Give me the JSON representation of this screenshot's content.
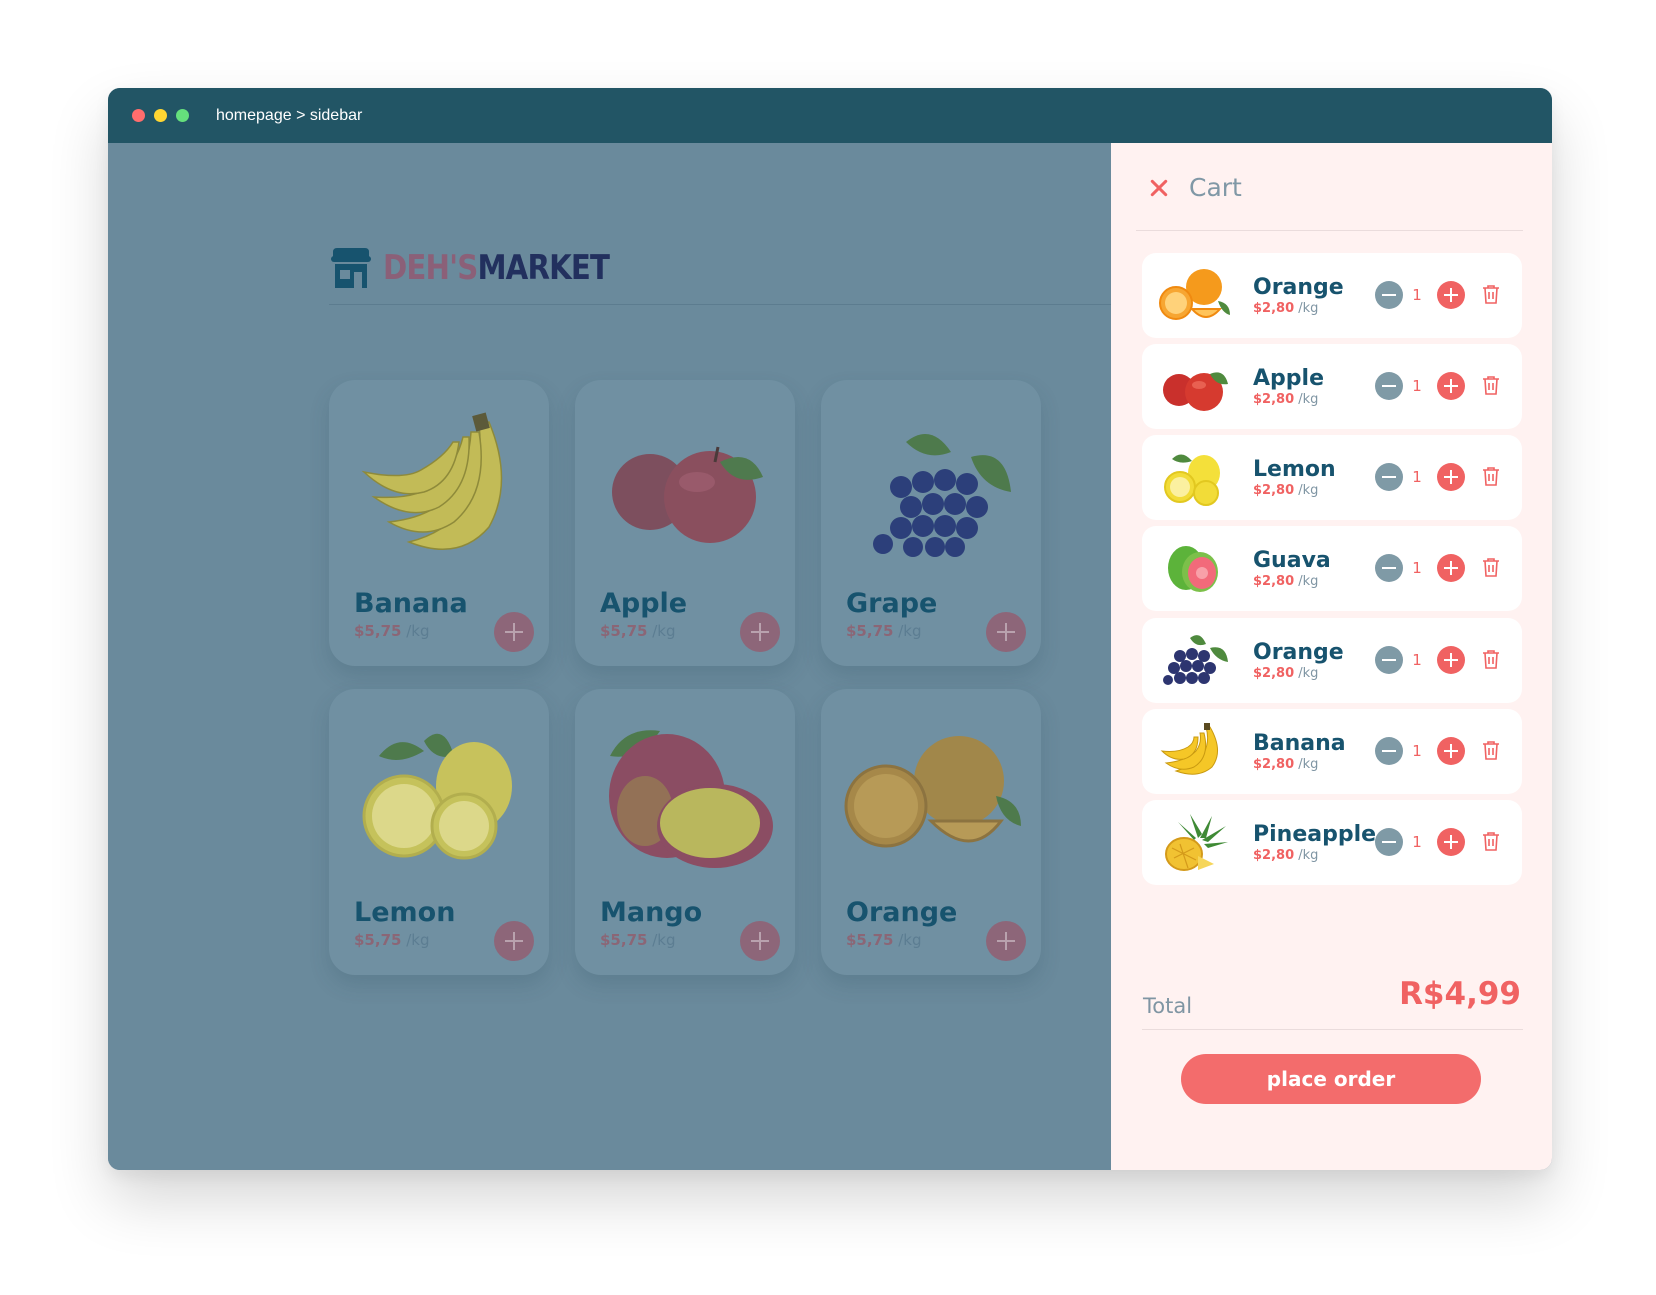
{
  "window": {
    "breadcrumb": "homepage > sidebar"
  },
  "brand": {
    "name_part1": "DEH'S",
    "name_part2": "MARKET",
    "colors": {
      "part1": "#8b6078",
      "part2": "#22305e"
    }
  },
  "products": [
    {
      "name": "Banana",
      "price": "$5,75",
      "unit": "/kg",
      "icon": "banana"
    },
    {
      "name": "Apple",
      "price": "$5,75",
      "unit": "/kg",
      "icon": "apple"
    },
    {
      "name": "Grape",
      "price": "$5,75",
      "unit": "/kg",
      "icon": "grape"
    },
    {
      "name": "Lemon",
      "price": "$5,75",
      "unit": "/kg",
      "icon": "lemon"
    },
    {
      "name": "Mango",
      "price": "$5,75",
      "unit": "/kg",
      "icon": "mango"
    },
    {
      "name": "Orange",
      "price": "$5,75",
      "unit": "/kg",
      "icon": "orange"
    }
  ],
  "cart": {
    "title": "Cart",
    "items": [
      {
        "name": "Orange",
        "price": "$2,80",
        "unit": "/kg",
        "qty": "1",
        "icon": "orange"
      },
      {
        "name": "Apple",
        "price": "$2,80",
        "unit": "/kg",
        "qty": "1",
        "icon": "apple"
      },
      {
        "name": "Lemon",
        "price": "$2,80",
        "unit": "/kg",
        "qty": "1",
        "icon": "lemon"
      },
      {
        "name": "Guava",
        "price": "$2,80",
        "unit": "/kg",
        "qty": "1",
        "icon": "guava"
      },
      {
        "name": "Orange",
        "price": "$2,80",
        "unit": "/kg",
        "qty": "1",
        "icon": "grape"
      },
      {
        "name": "Banana",
        "price": "$2,80",
        "unit": "/kg",
        "qty": "1",
        "icon": "banana"
      },
      {
        "name": "Pineapple",
        "price": "$2,80",
        "unit": "/kg",
        "qty": "1",
        "icon": "pineapple"
      }
    ],
    "total_label": "Total",
    "total_value": "R$4,99",
    "order_button": "place order"
  },
  "colors": {
    "accent": "#f06262",
    "titlebar": "#225565",
    "overlay": "#6a8a9c",
    "sidebar_bg": "#fff2f1",
    "text_dark": "#17536e"
  }
}
